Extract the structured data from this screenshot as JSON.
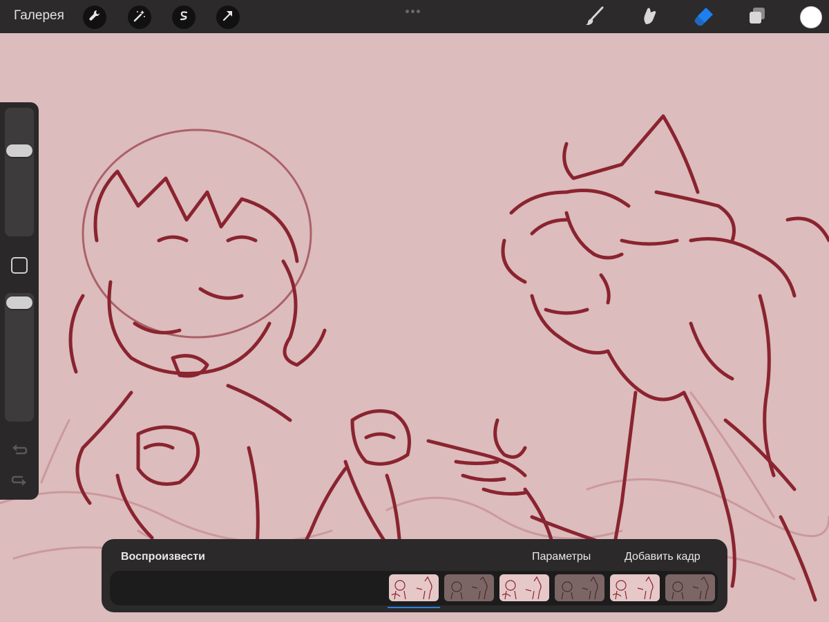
{
  "topbar": {
    "gallery_label": "Галерея",
    "left_tools": [
      "wrench-icon",
      "magic-wand-icon",
      "selection-icon",
      "transform-arrow-icon"
    ],
    "right_tools": [
      "brush-icon",
      "smudge-icon",
      "eraser-icon",
      "layers-icon"
    ],
    "active_tool": "eraser",
    "current_color": "#ffffff",
    "accent": "#1e7ff0"
  },
  "sidebar": {
    "controls": [
      "brush-size-slider",
      "modify-button",
      "opacity-slider",
      "undo-icon",
      "redo-icon"
    ]
  },
  "animation": {
    "play_label": "Воспроизвести",
    "settings_label": "Параметры",
    "add_frame_label": "Добавить кадр",
    "frame_count": 6,
    "selected_frame": 1
  },
  "canvas": {
    "background": "#dcbcbc",
    "stroke_color": "#8a2430",
    "onion_color": "#c88e94"
  }
}
